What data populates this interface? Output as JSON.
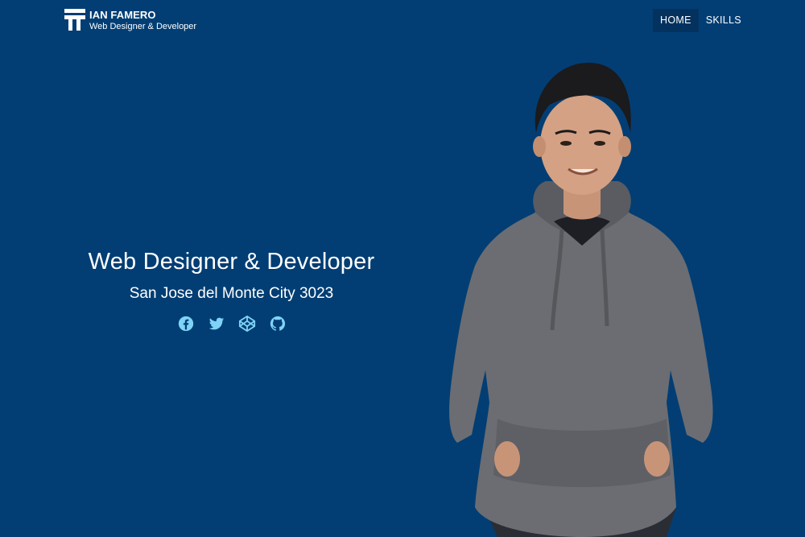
{
  "brand": {
    "name": "IAN FAMERO",
    "tagline": "Web Designer & Developer"
  },
  "nav": {
    "items": [
      {
        "label": "HOME",
        "active": true
      },
      {
        "label": "SKILLS",
        "active": false
      }
    ]
  },
  "hero": {
    "title": "Web Designer & Developer",
    "location": "San Jose del Monte City 3023",
    "socials": [
      "facebook-icon",
      "twitter-icon",
      "codepen-icon",
      "github-icon"
    ]
  },
  "colors": {
    "background": "#023e74",
    "nav_active": "#04325f",
    "social_icon": "#7fd3f7",
    "text": "#ffffff"
  }
}
